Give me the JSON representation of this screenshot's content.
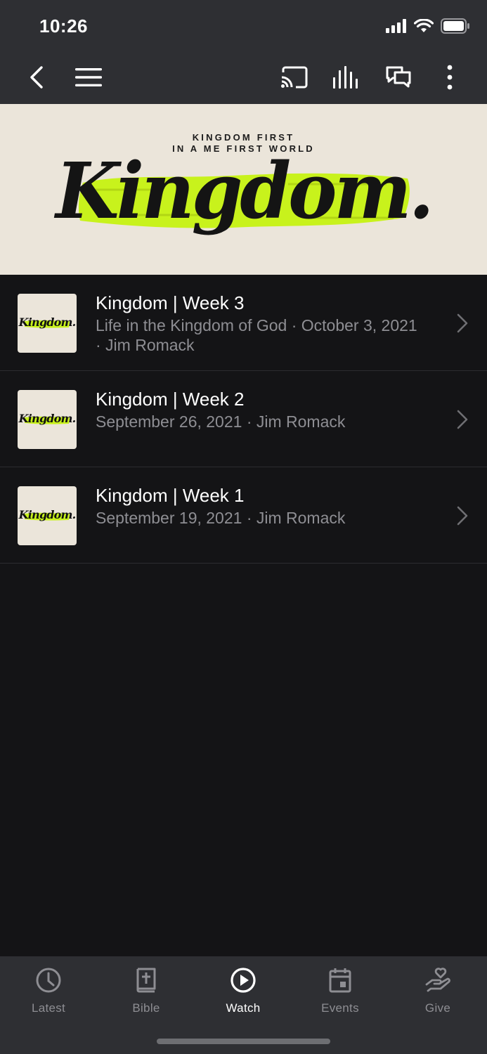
{
  "status": {
    "time": "10:26"
  },
  "toolbar": {
    "back_icon": "chevron-left-icon",
    "menu_icon": "hamburger-menu-icon",
    "cast_icon": "cast-icon",
    "audio_icon": "audio-bars-icon",
    "chat_icon": "chat-bubbles-icon",
    "more_icon": "more-vertical-icon"
  },
  "banner": {
    "tagline_line1": "KINGDOM FIRST",
    "tagline_line2": "IN A ME FIRST WORLD",
    "wordmark": "Kingdom.",
    "accent_color": "#c8f21c"
  },
  "sermons": [
    {
      "title": "Kingdom | Week 3",
      "subtitle_line1": "Life in the Kingdom of God · October 3, 2021",
      "subtitle_line2": "· Jim Romack",
      "thumb_text": "Kingdom."
    },
    {
      "title": "Kingdom | Week 2",
      "subtitle_line1": "September 26, 2021 · Jim Romack",
      "subtitle_line2": "",
      "thumb_text": "Kingdom."
    },
    {
      "title": "Kingdom | Week 1",
      "subtitle_line1": "September 19, 2021 · Jim Romack",
      "subtitle_line2": "",
      "thumb_text": "Kingdom."
    }
  ],
  "tabs": [
    {
      "label": "Latest",
      "icon": "clock-icon",
      "active": false
    },
    {
      "label": "Bible",
      "icon": "bible-icon",
      "active": false
    },
    {
      "label": "Watch",
      "icon": "play-circle-icon",
      "active": true
    },
    {
      "label": "Events",
      "icon": "calendar-icon",
      "active": false
    },
    {
      "label": "Give",
      "icon": "give-heart-hand-icon",
      "active": false
    }
  ]
}
